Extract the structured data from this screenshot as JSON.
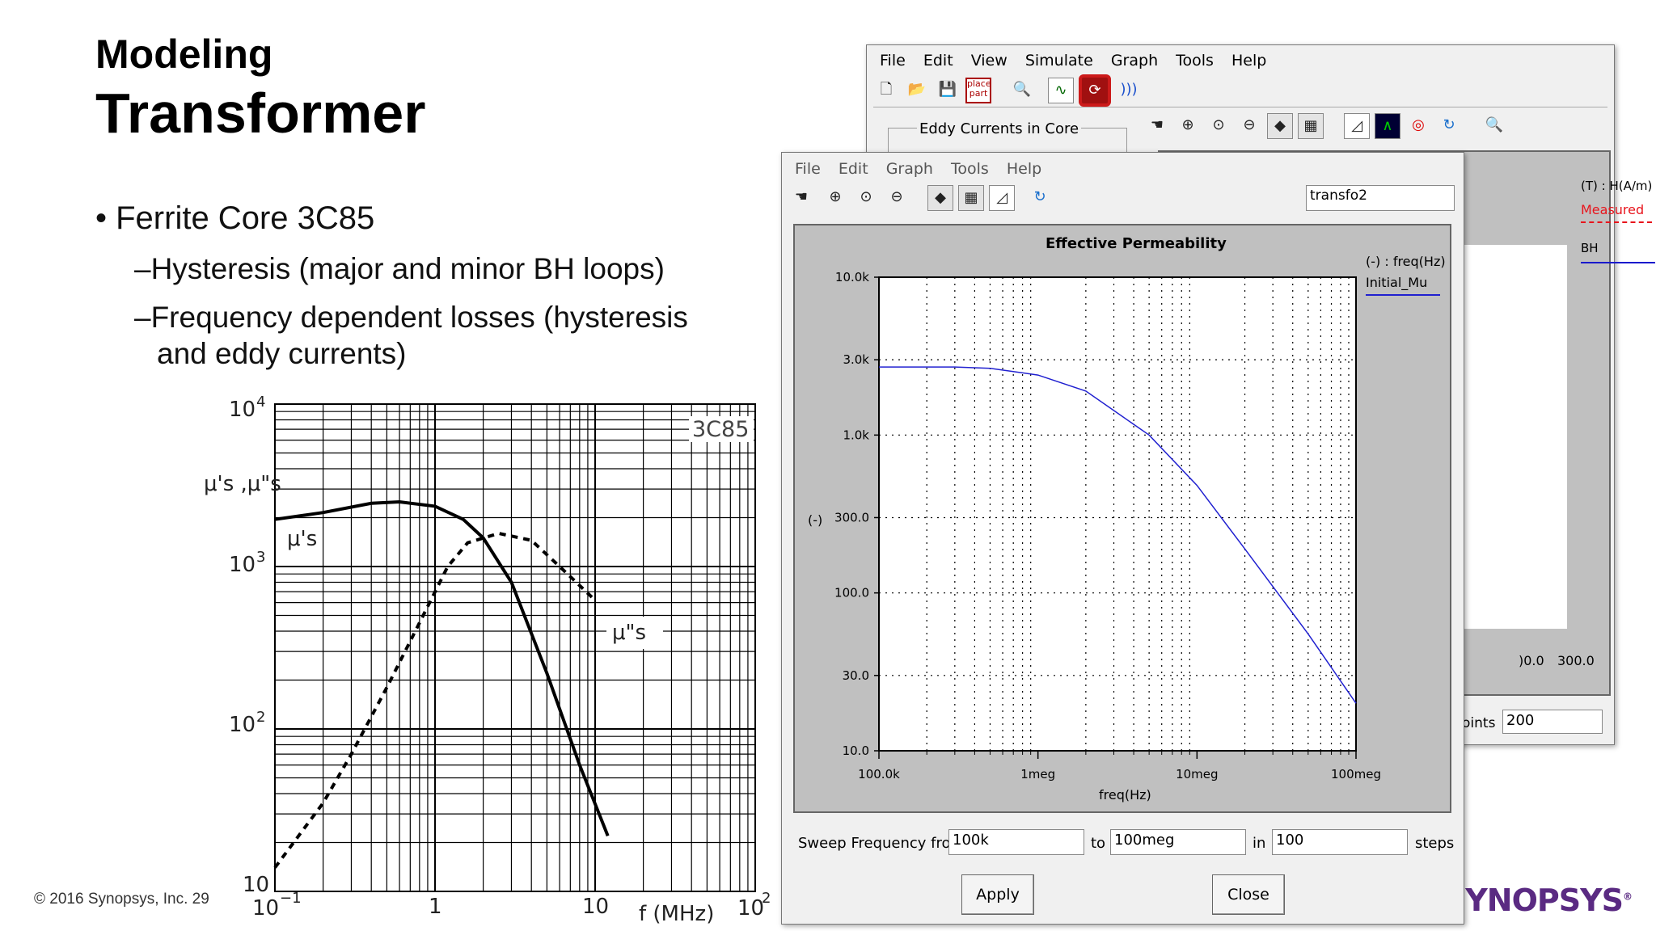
{
  "slide": {
    "title_small": "Modeling",
    "title_large": "Transformer",
    "bullet_main": "Ferrite Core 3C85",
    "sub_bullets": [
      "Hysteresis (major and minor BH loops)",
      "Frequency dependent losses (hysteresis",
      "and eddy currents)"
    ],
    "footer": "© 2016 Synopsys, Inc.   29",
    "logo": "SYNOPSYS"
  },
  "datasheet_chart": {
    "material_label": "3C85",
    "y_axis_label": "μ's ,μ\"s",
    "curve_label_real": "μ's",
    "curve_label_imag": "μ\"s",
    "y_ticks": [
      "10",
      "2",
      "10",
      "3",
      "10",
      "4",
      "10"
    ],
    "x_ticks": [
      "10",
      "−1",
      "1",
      "10",
      "10",
      "2"
    ],
    "x_axis_label": "f  (MHz)"
  },
  "chart_data": [
    {
      "type": "line",
      "title": "",
      "xlabel": "f (MHz)",
      "ylabel": "μ's ,μ\"s",
      "xscale": "log",
      "yscale": "log",
      "xlim": [
        0.1,
        100
      ],
      "ylim": [
        10,
        10000
      ],
      "series": [
        {
          "name": "μ's",
          "x": [
            0.1,
            0.2,
            0.4,
            0.6,
            1.0,
            1.5,
            2.0,
            3.0,
            5.0,
            8.0,
            12.0
          ],
          "y": [
            1950,
            2150,
            2450,
            2500,
            2350,
            1950,
            1500,
            800,
            220,
            60,
            22
          ]
        },
        {
          "name": "μ\"s",
          "x": [
            0.1,
            0.2,
            0.3,
            0.5,
            0.8,
            1.2,
            1.6,
            2.5,
            4.0,
            6.0,
            10.0
          ],
          "y": [
            14,
            35,
            70,
            180,
            450,
            1000,
            1400,
            1600,
            1450,
            1000,
            620
          ]
        }
      ]
    },
    {
      "type": "line",
      "title": "Effective Permeability",
      "xlabel": "freq(Hz)",
      "ylabel": "(-)",
      "xscale": "log",
      "yscale": "log",
      "xlim": [
        100000,
        100000000
      ],
      "ylim": [
        10,
        10000
      ],
      "series": [
        {
          "name": "Initial_Mu",
          "x": [
            100000,
            300000,
            500000,
            1000000,
            2000000,
            5000000,
            10000000,
            20000000,
            50000000,
            100000000
          ],
          "y": [
            2700,
            2700,
            2650,
            2400,
            1900,
            1000,
            480,
            190,
            55,
            20
          ]
        }
      ]
    }
  ],
  "back_window": {
    "menu": [
      "File",
      "Edit",
      "View",
      "Simulate",
      "Graph",
      "Tools",
      "Help"
    ],
    "toolbar_icons": [
      "new-file-icon",
      "open-folder-icon",
      "save-icon",
      "place-part-icon",
      "netlist-icon",
      "graph-icon",
      "run-simulation-icon",
      "waveform-icon"
    ],
    "place_part_label": "place\npart",
    "group_label": "Eddy Currents in Core",
    "legend_header": "(T) : H(A/m)",
    "legend_measured": "Measured",
    "legend_bh": "BH",
    "x_tick_a": ")0.0",
    "x_tick_b": "300.0",
    "points_label": "oints",
    "points_value": "200",
    "colors": {
      "measured": "#e8141c",
      "bh": "#1a1acc",
      "accent": "#cc1a1a"
    }
  },
  "front_window": {
    "menu": [
      "File",
      "Edit",
      "Graph",
      "Tools",
      "Help"
    ],
    "dropdown_value": "transfo2",
    "plot_title": "Effective Permeability",
    "legend_header": "(-) : freq(Hz)",
    "legend_item": "Initial_Mu",
    "y_axis_unit": "(-)",
    "y_ticks": [
      "10.0k",
      "3.0k",
      "1.0k",
      "300.0",
      "100.0",
      "30.0",
      "10.0"
    ],
    "x_ticks": [
      "100.0k",
      "1meg",
      "10meg",
      "100meg"
    ],
    "x_axis_label": "freq(Hz)",
    "sweep_label": "Sweep Frequency from",
    "sweep_from": "100k",
    "to_label": "to",
    "sweep_to": "100meg",
    "in_label": "in",
    "steps_value": "100",
    "steps_label": "steps",
    "apply_button": "Apply",
    "close_button": "Close",
    "colors": {
      "curve": "#2020d0",
      "plot_bg": "#c0c0c0"
    }
  }
}
